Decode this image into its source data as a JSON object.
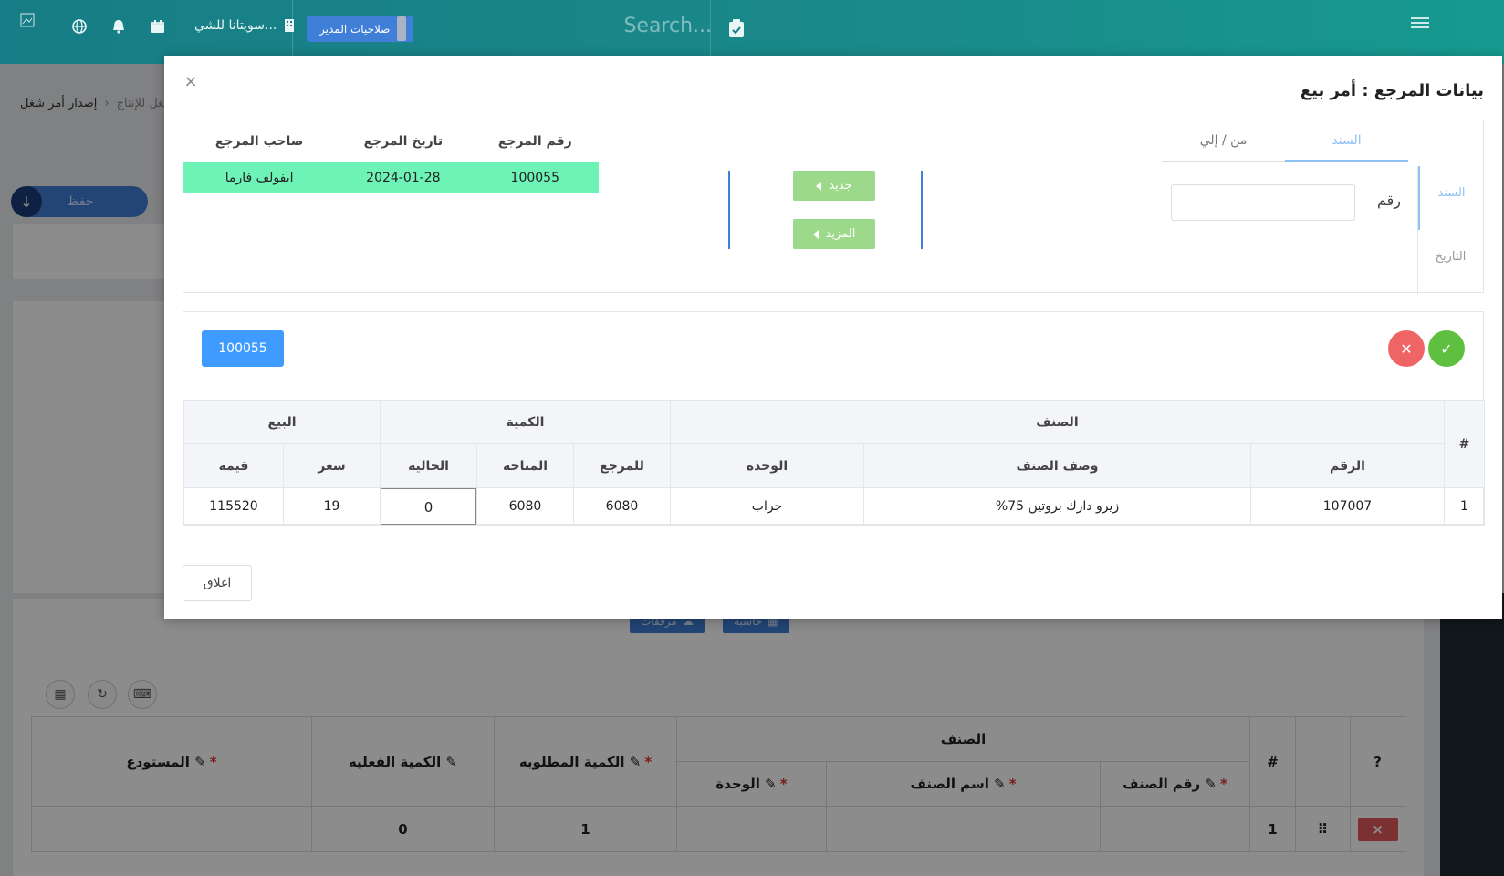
{
  "topbar": {
    "search_placeholder": "Search...",
    "admin_label": "صلاحيات المدير",
    "company_label": "سويتانا للشي...",
    "icons": [
      "hamburger-icon",
      "clipboard-check-icon",
      "calendar-icon",
      "bell-icon",
      "globe-icon",
      "broken-image-icon"
    ]
  },
  "background": {
    "breadcrumb": {
      "parent": "الشغل للإنتاج",
      "current": "إصدار أمر شغل"
    },
    "save_label": "حفظ",
    "buttons": {
      "attachments": "مرفقات",
      "calculator": "حاسبة"
    },
    "table": {
      "group_header": "الصنف",
      "headers": {
        "hash": "#",
        "item_number": "رقم الصنف",
        "item_name": "اسم الصنف",
        "unit": "الوحدة",
        "required_qty": "الكمية المطلوبه",
        "actual_qty": "الكمية الفعليه",
        "warehouse": "المستودع"
      },
      "row": {
        "index": "1",
        "required_qty": "1",
        "actual_qty": "0",
        "delete": "×"
      }
    }
  },
  "modal": {
    "title": "بيانات المرجع : أمر بيع",
    "close_icon": "×",
    "tabs": [
      {
        "label": "السند",
        "active": true
      },
      {
        "label": "من / إلي",
        "active": false
      }
    ],
    "vtabs": [
      {
        "label": "السند",
        "active": true
      },
      {
        "label": "التاريخ",
        "active": false
      }
    ],
    "number_label": "رقم",
    "number_value": "",
    "new_button": "جديد",
    "more_button": "المزيد",
    "ref_table": {
      "headers": {
        "ref_number": "رقم المرجع",
        "ref_date": "تاريخ المرجع",
        "ref_owner": "صاحب المرجع"
      },
      "row": {
        "ref_number": "100055",
        "ref_date": "2024-01-28",
        "ref_owner": "ايفولف فارما"
      }
    },
    "selected_ref": "100055",
    "items_table": {
      "groups": {
        "item": "الصنف",
        "quantity": "الكمية",
        "sale": "البيع"
      },
      "headers": {
        "hash": "#",
        "number": "الرقم",
        "description": "وصف الصنف",
        "unit": "الوحدة",
        "for_ref": "للمرجع",
        "available": "المتاحة",
        "current": "الحالية",
        "price": "سعر",
        "value": "قيمة"
      },
      "rows": [
        {
          "index": "1",
          "number": "107007",
          "description": "زيرو دارك بروتين 75%",
          "unit": "جراب",
          "for_ref": "6080",
          "available": "6080",
          "current": "0",
          "price": "19",
          "value": "115520"
        }
      ]
    },
    "close_button": "اغلاق",
    "colors": {
      "accent": "#3f9bff",
      "selected_row": "#6ef3b7",
      "confirm": "#5fbf3f",
      "cancel": "#ef6565"
    }
  }
}
